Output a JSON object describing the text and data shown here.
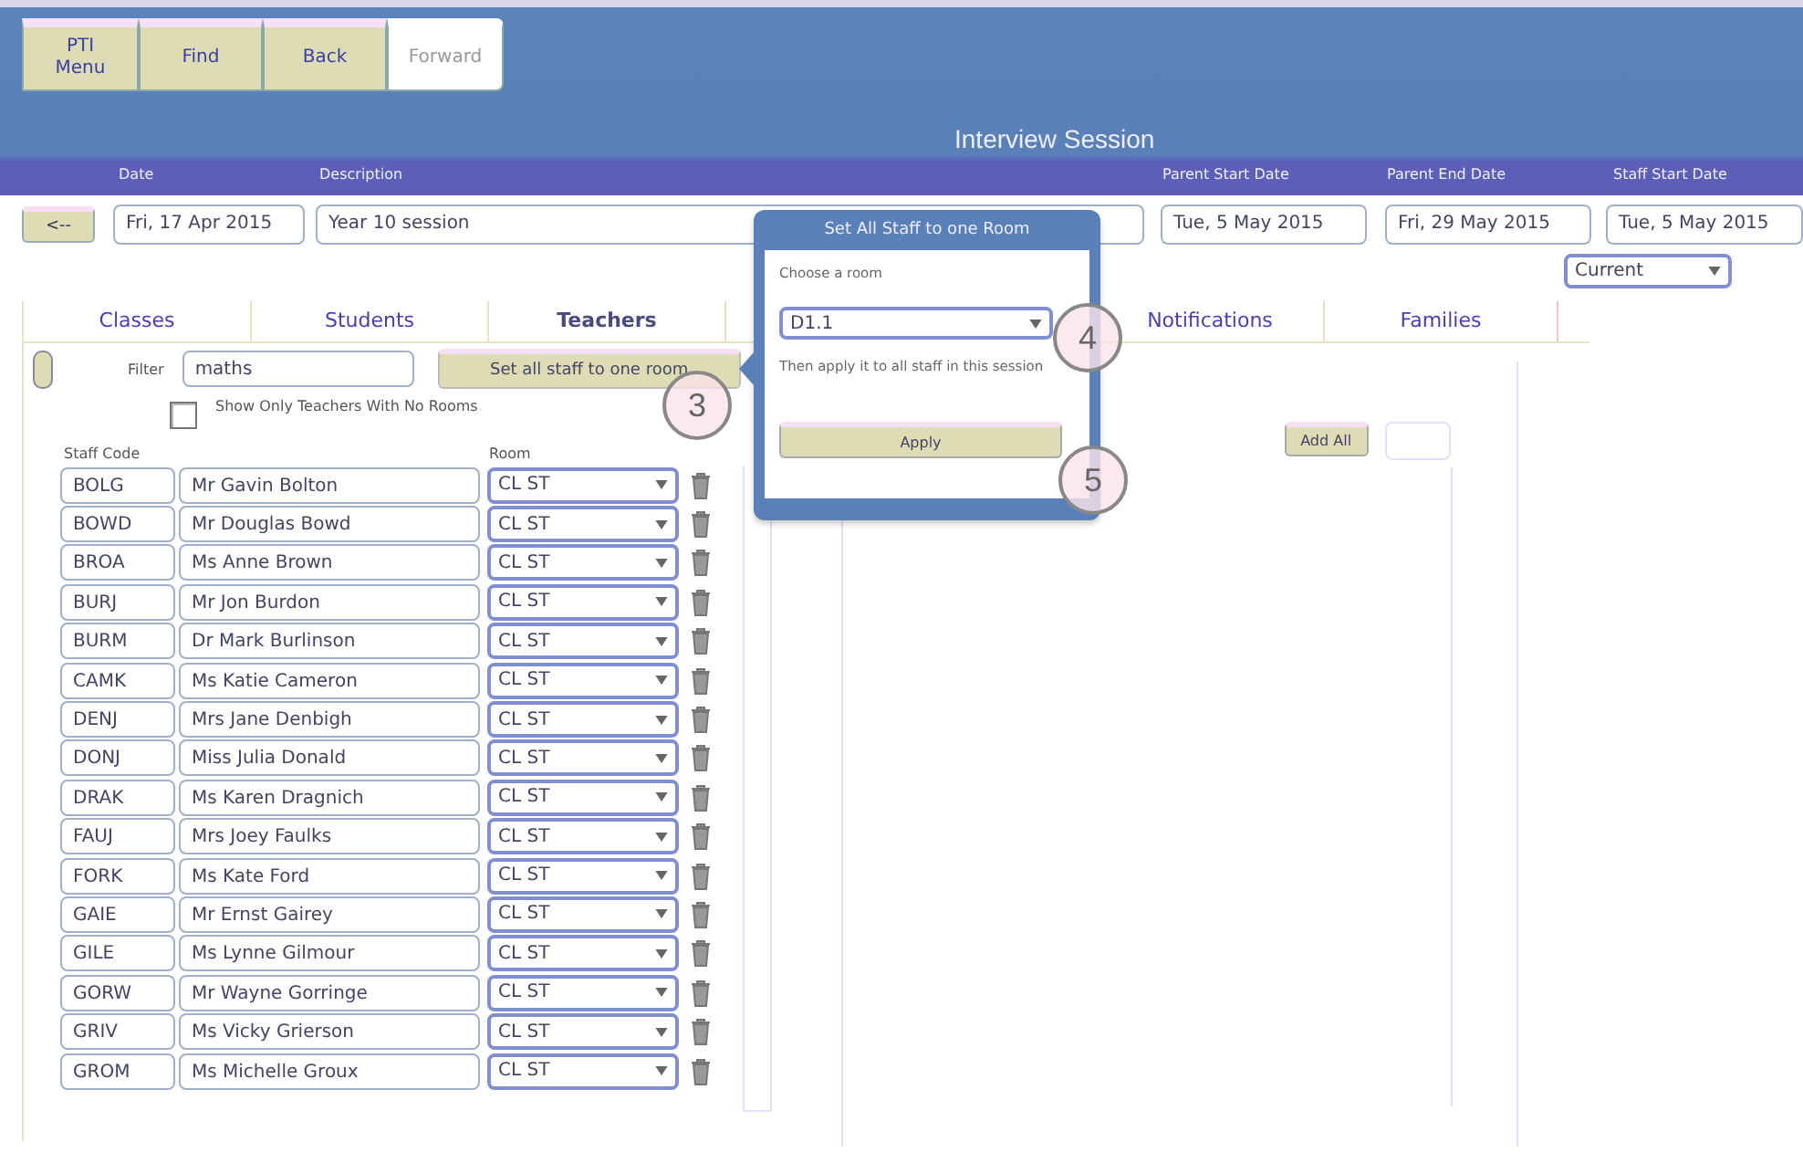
{
  "nav_buttons": [
    {
      "label": "PTI\nMenu",
      "disabled": false
    },
    {
      "label": "Find",
      "disabled": false
    },
    {
      "label": "Back",
      "disabled": false
    },
    {
      "label": "Forward",
      "disabled": true
    }
  ],
  "window": {
    "title": "Interview Session"
  },
  "back_button": "<--",
  "session_fields": [
    {
      "label": "Date",
      "value": "Fri, 17 Apr 2015"
    },
    {
      "label": "Description",
      "value": "Year 10 session"
    },
    {
      "label": "Parent Start Date",
      "value": "Tue, 5 May 2015"
    },
    {
      "label": "Parent End Date",
      "value": "Fri, 29 May 2015"
    },
    {
      "label": "Staff Start Date",
      "value": "Tue, 5 May 2015"
    }
  ],
  "status_select": "Current",
  "tabs": [
    {
      "label": "Classes",
      "selected": false
    },
    {
      "label": "Students",
      "selected": false
    },
    {
      "label": "Teachers",
      "selected": true
    },
    {
      "label": "Notifications",
      "selected": false
    },
    {
      "label": "Families",
      "selected": false
    }
  ],
  "filter": {
    "label": "Filter",
    "value": "maths"
  },
  "set_all_button": "Set all staff to one room",
  "no_rooms_checkbox": {
    "label": "Show Only Teachers With No Rooms",
    "checked": false
  },
  "table": {
    "columns": [
      "Staff Code",
      "Room"
    ],
    "rows": [
      {
        "code": "BOLG",
        "name": "Mr Gavin Bolton",
        "room": "CL ST"
      },
      {
        "code": "BOWD",
        "name": "Mr Douglas Bowd",
        "room": "CL ST"
      },
      {
        "code": "BROA",
        "name": "Ms Anne Brown",
        "room": "CL ST"
      },
      {
        "code": "BURJ",
        "name": "Mr Jon Burdon",
        "room": "CL ST"
      },
      {
        "code": "BURM",
        "name": "Dr Mark Burlinson",
        "room": "CL ST"
      },
      {
        "code": "CAMK",
        "name": "Ms Katie Cameron",
        "room": "CL ST"
      },
      {
        "code": "DENJ",
        "name": "Mrs Jane Denbigh",
        "room": "CL ST"
      },
      {
        "code": "DONJ",
        "name": "Miss Julia Donald",
        "room": "CL ST"
      },
      {
        "code": "DRAK",
        "name": "Ms Karen Dragnich",
        "room": "CL ST"
      },
      {
        "code": "FAUJ",
        "name": "Mrs Joey Faulks",
        "room": "CL ST"
      },
      {
        "code": "FORK",
        "name": "Ms Kate Ford",
        "room": "CL ST"
      },
      {
        "code": "GAIE",
        "name": "Mr Ernst Gairey",
        "room": "CL ST"
      },
      {
        "code": "GILE",
        "name": "Ms Lynne Gilmour",
        "room": "CL ST"
      },
      {
        "code": "GORW",
        "name": "Mr Wayne Gorringe",
        "room": "CL ST"
      },
      {
        "code": "GRIV",
        "name": "Ms Vicky Grierson",
        "room": "CL ST"
      },
      {
        "code": "GROM",
        "name": "Ms Michelle Groux",
        "room": "CL ST"
      }
    ]
  },
  "add_all_button": "Add All",
  "popover": {
    "title": "Set All Staff to one Room",
    "prompt": "Choose a room",
    "room": "D1.1",
    "hint": "Then apply it to all staff in this session",
    "apply_button": "Apply"
  },
  "step_markers": [
    "3",
    "4",
    "5"
  ]
}
